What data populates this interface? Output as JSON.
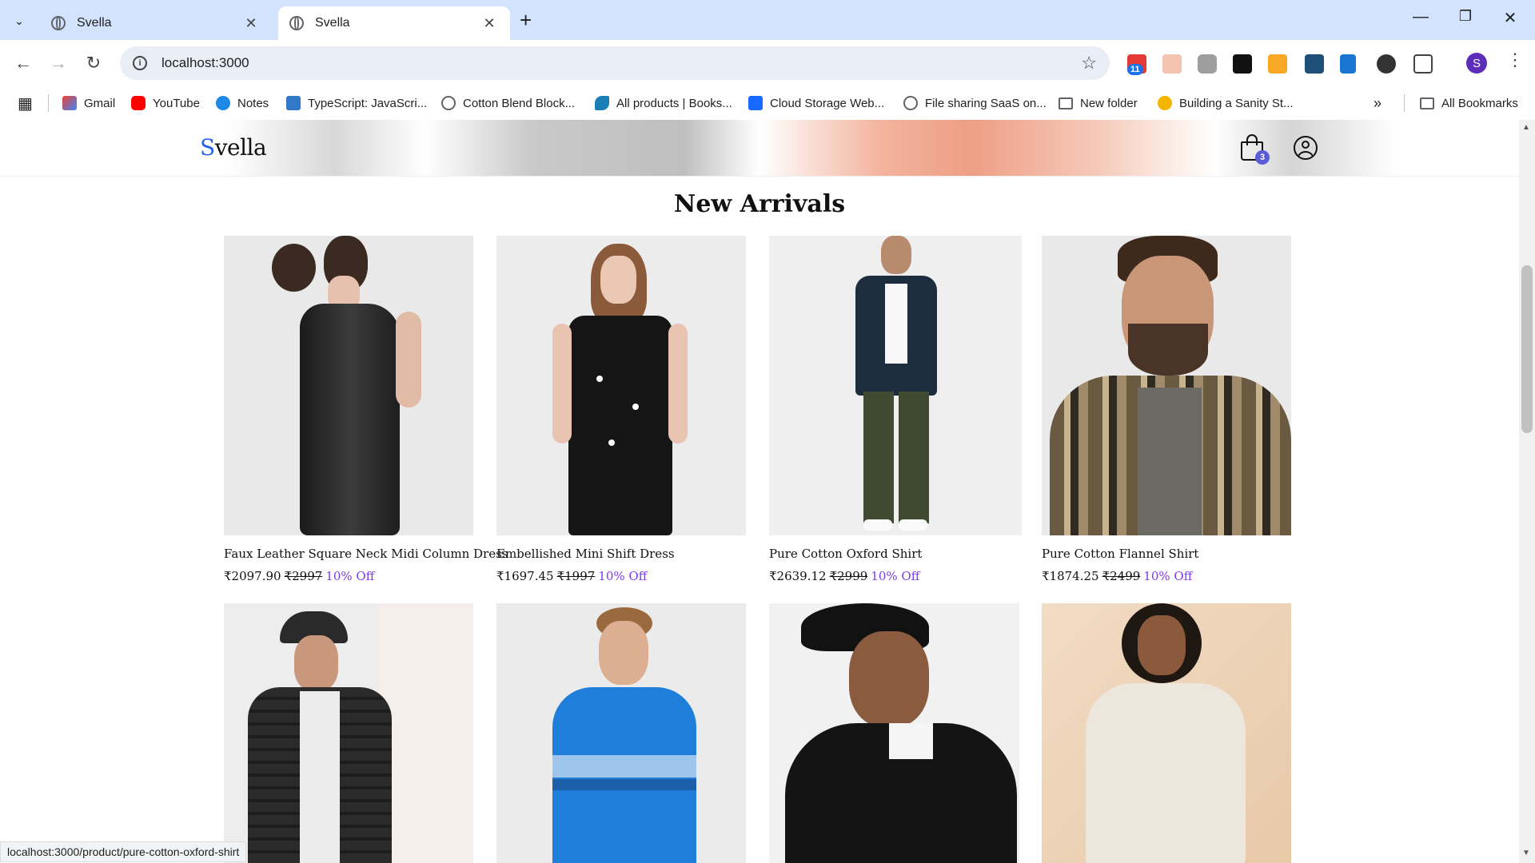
{
  "browser": {
    "tabs": [
      {
        "title": "Svella",
        "active": false
      },
      {
        "title": "Svella",
        "active": true
      }
    ],
    "url": "localhost:3000",
    "extension_badge": "11",
    "profile_initial": "S",
    "bookmarks": [
      {
        "label": "Gmail",
        "icon": "gmail-icon"
      },
      {
        "label": "YouTube",
        "icon": "youtube-icon"
      },
      {
        "label": "Notes",
        "icon": "cloud-icon"
      },
      {
        "label": "TypeScript: JavaScri...",
        "icon": "typescript-icon"
      },
      {
        "label": "Cotton Blend Block...",
        "icon": "globe-icon"
      },
      {
        "label": "All products | Books...",
        "icon": "leaf-icon"
      },
      {
        "label": "Cloud Storage Web...",
        "icon": "behance-icon"
      },
      {
        "label": "File sharing SaaS on...",
        "icon": "globe-icon"
      },
      {
        "label": "New folder",
        "icon": "folder-icon"
      },
      {
        "label": "Building a Sanity St...",
        "icon": "sanity-icon"
      }
    ],
    "all_bookmarks": "All Bookmarks",
    "status_url": "localhost:3000/product/pure-cotton-oxford-shirt"
  },
  "site": {
    "logo_first": "S",
    "logo_rest": "vella",
    "cart_count": "3",
    "section_title": "New Arrivals",
    "accent_color": "#7c3aed",
    "products": [
      {
        "name": "Faux Leather Square Neck Midi Column Dress",
        "price": "₹2097.90",
        "mrp": "₹2997",
        "discount": "10% Off"
      },
      {
        "name": "Embellished Mini Shift Dress",
        "price": "₹1697.45",
        "mrp": "₹1997",
        "discount": "10% Off"
      },
      {
        "name": "Pure Cotton Oxford Shirt",
        "price": "₹2639.12",
        "mrp": "₹2999",
        "discount": "10% Off"
      },
      {
        "name": "Pure Cotton Flannel Shirt",
        "price": "₹1874.25",
        "mrp": "₹2499",
        "discount": "10% Off"
      }
    ]
  }
}
